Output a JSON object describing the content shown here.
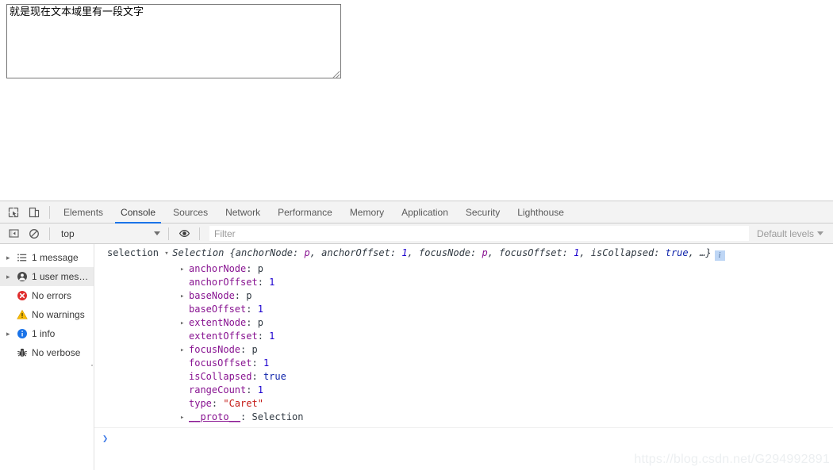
{
  "page": {
    "textarea": {
      "value": "就是现在文本域里有一段文字",
      "placeholder": ""
    }
  },
  "devtools": {
    "toolbar": {
      "inspect_icon": "inspect-element-icon",
      "device_icon": "device-toolbar-icon",
      "tabs": [
        {
          "label": "Elements",
          "active": false
        },
        {
          "label": "Console",
          "active": true
        },
        {
          "label": "Sources",
          "active": false
        },
        {
          "label": "Network",
          "active": false
        },
        {
          "label": "Performance",
          "active": false
        },
        {
          "label": "Memory",
          "active": false
        },
        {
          "label": "Application",
          "active": false
        },
        {
          "label": "Security",
          "active": false
        },
        {
          "label": "Lighthouse",
          "active": false
        }
      ],
      "active_tab_underline_color": "#1a73e8"
    },
    "filterbar": {
      "sidebar_toggle_icon": "console-sidebar-toggle-icon",
      "clear_icon": "clear-console-icon",
      "context_value": "top",
      "eye_icon": "live-expression-eye-icon",
      "filter_placeholder": "Filter",
      "filter_value": "",
      "levels_label": "Default levels"
    },
    "sidebar": {
      "items": [
        {
          "label": "1 message",
          "icon": "list-icon",
          "expandable": true,
          "selected": false
        },
        {
          "label": "1 user mes…",
          "icon": "user-icon",
          "expandable": true,
          "selected": true
        },
        {
          "label": "No errors",
          "icon": "error-icon",
          "expandable": false,
          "selected": false
        },
        {
          "label": "No warnings",
          "icon": "warning-icon",
          "expandable": false,
          "selected": false
        },
        {
          "label": "1 info",
          "icon": "info-icon",
          "expandable": true,
          "selected": false
        },
        {
          "label": "No verbose",
          "icon": "bug-icon",
          "expandable": false,
          "selected": false
        }
      ]
    },
    "console": {
      "expression": "selection",
      "result": {
        "constructor": "Selection",
        "preview_open": "{",
        "preview_props": [
          {
            "key": "anchorNode",
            "sep": ": ",
            "value": "p",
            "kind": "node",
            "comma": ", "
          },
          {
            "key": "anchorOffset",
            "sep": ": ",
            "value": "1",
            "kind": "num",
            "comma": ", "
          },
          {
            "key": "focusNode",
            "sep": ": ",
            "value": "p",
            "kind": "node",
            "comma": ", "
          },
          {
            "key": "focusOffset",
            "sep": ": ",
            "value": "1",
            "kind": "num",
            "comma": ", "
          },
          {
            "key": "isCollapsed",
            "sep": ": ",
            "value": "true",
            "kind": "bool",
            "comma": ", "
          }
        ],
        "preview_ellipsis": "…}",
        "info_badge": "i"
      },
      "properties": [
        {
          "key": "anchorNode",
          "value": "p",
          "kind": "node",
          "expandable": true
        },
        {
          "key": "anchorOffset",
          "value": "1",
          "kind": "num",
          "expandable": false
        },
        {
          "key": "baseNode",
          "value": "p",
          "kind": "node",
          "expandable": true
        },
        {
          "key": "baseOffset",
          "value": "1",
          "kind": "num",
          "expandable": false
        },
        {
          "key": "extentNode",
          "value": "p",
          "kind": "node",
          "expandable": true
        },
        {
          "key": "extentOffset",
          "value": "1",
          "kind": "num",
          "expandable": false
        },
        {
          "key": "focusNode",
          "value": "p",
          "kind": "node",
          "expandable": true
        },
        {
          "key": "focusOffset",
          "value": "1",
          "kind": "num",
          "expandable": false
        },
        {
          "key": "isCollapsed",
          "value": "true",
          "kind": "bool",
          "expandable": false
        },
        {
          "key": "rangeCount",
          "value": "1",
          "kind": "num",
          "expandable": false
        },
        {
          "key": "type",
          "value": "\"Caret\"",
          "kind": "str",
          "expandable": false
        },
        {
          "key": "__proto__",
          "value": "Selection",
          "kind": "proto",
          "expandable": true
        }
      ],
      "prompt_symbol": "❯"
    }
  },
  "watermark": "https://blog.csdn.net/G294992891"
}
